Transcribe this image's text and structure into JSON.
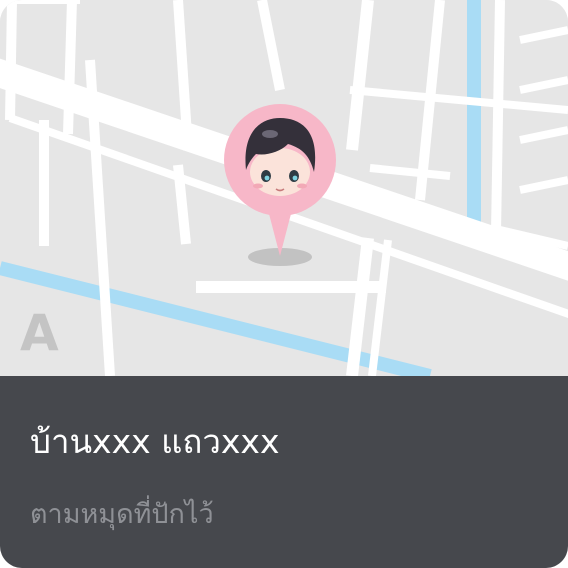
{
  "map": {
    "letter_marker": "A",
    "pin_icon": "avatar-pin-icon"
  },
  "place": {
    "name": "บ้านxxx แถวxxx",
    "subtitle": "ตามหมุดที่ปักไว้"
  },
  "colors": {
    "map_background": "#e6e6e6",
    "road": "#ffffff",
    "water": "#a9dcf5",
    "pin": "#f7b7c8",
    "info_background": "#46484d",
    "subtitle_text": "#8f9196"
  }
}
